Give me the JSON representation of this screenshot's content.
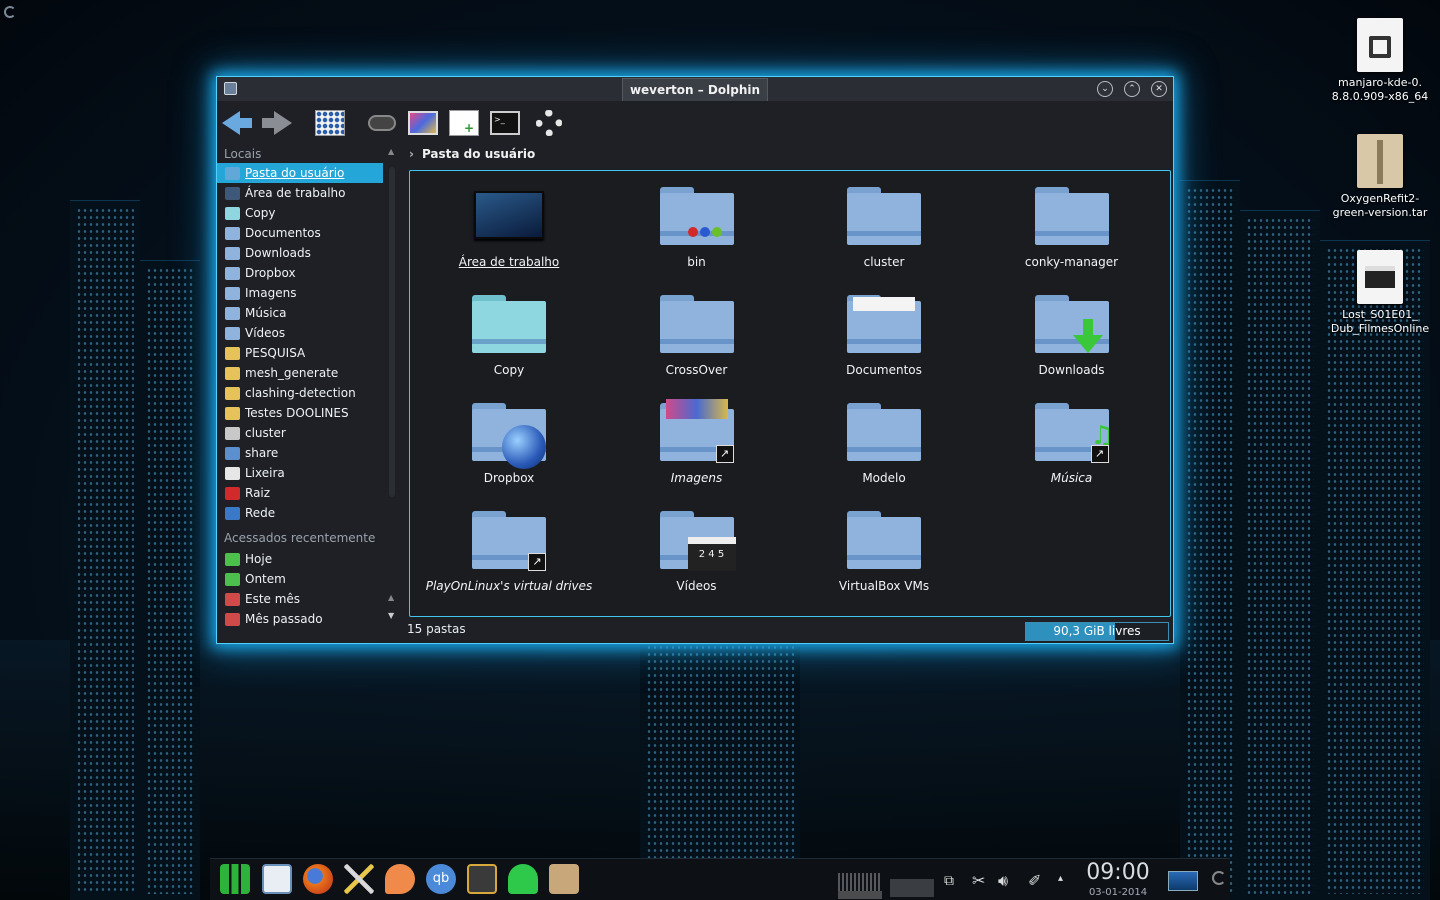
{
  "window": {
    "title": "weverton – Dolphin",
    "buttons": {
      "minimize": "⌄",
      "maximize": "⌃",
      "close": "✕"
    }
  },
  "sidebar": {
    "places_title": "Locais",
    "places": [
      {
        "label": "Pasta do usuário",
        "icon": "home-folder-icon",
        "color": "#5fa8d8",
        "selected": true
      },
      {
        "label": "Área de trabalho",
        "icon": "desktop-icon",
        "color": "#3d5878"
      },
      {
        "label": "Copy",
        "icon": "folder-icon",
        "color": "#8ed6e0"
      },
      {
        "label": "Documentos",
        "icon": "documents-folder-icon",
        "color": "#8fb3dd"
      },
      {
        "label": "Downloads",
        "icon": "downloads-folder-icon",
        "color": "#8fb3dd"
      },
      {
        "label": "Dropbox",
        "icon": "dropbox-folder-icon",
        "color": "#8fb3dd"
      },
      {
        "label": "Imagens",
        "icon": "pictures-folder-icon",
        "color": "#8fb3dd"
      },
      {
        "label": "Música",
        "icon": "music-folder-icon",
        "color": "#8fb3dd"
      },
      {
        "label": "Vídeos",
        "icon": "videos-folder-icon",
        "color": "#8fb3dd"
      },
      {
        "label": "PESQUISA",
        "icon": "yellow-folder-icon",
        "color": "#e6c25a"
      },
      {
        "label": "mesh_generate",
        "icon": "yellow-folder-icon",
        "color": "#e6c25a"
      },
      {
        "label": "clashing-detection",
        "icon": "yellow-folder-icon",
        "color": "#e6c25a"
      },
      {
        "label": "Testes DOOLINES",
        "icon": "yellow-folder-icon",
        "color": "#e6c25a"
      },
      {
        "label": "cluster",
        "icon": "drive-icon",
        "color": "#c8c8c8"
      },
      {
        "label": "share",
        "icon": "network-share-icon",
        "color": "#5b8fd0"
      },
      {
        "label": "Lixeira",
        "icon": "trash-icon",
        "color": "#e6e6e6"
      },
      {
        "label": "Raiz",
        "icon": "root-folder-icon",
        "color": "#d02a2a"
      },
      {
        "label": "Rede",
        "icon": "network-globe-icon",
        "color": "#3a78c8"
      }
    ],
    "recent_title": "Acessados recentemente",
    "recent": [
      {
        "label": "Hoje",
        "icon": "calendar-today-icon",
        "color": "#4cbf4c"
      },
      {
        "label": "Ontem",
        "icon": "calendar-yesterday-icon",
        "color": "#4cbf4c"
      },
      {
        "label": "Este mês",
        "icon": "calendar-month-icon",
        "color": "#d04a4a"
      },
      {
        "label": "Mês passado",
        "icon": "calendar-last-month-icon",
        "color": "#d04a4a"
      }
    ]
  },
  "breadcrumb": {
    "chevron": "›",
    "path": "Pasta do usuário"
  },
  "files": [
    {
      "name": "Área de trabalho",
      "kind": "desktop",
      "underline": true
    },
    {
      "name": "bin",
      "kind": "folder-dots"
    },
    {
      "name": "cluster",
      "kind": "folder"
    },
    {
      "name": "conky-manager",
      "kind": "folder"
    },
    {
      "name": "Copy",
      "kind": "folder-teal"
    },
    {
      "name": "CrossOver",
      "kind": "folder"
    },
    {
      "name": "Documentos",
      "kind": "folder-docs"
    },
    {
      "name": "Downloads",
      "kind": "folder-download"
    },
    {
      "name": "Dropbox",
      "kind": "folder-globe"
    },
    {
      "name": "Imagens",
      "kind": "folder-images",
      "italic": true,
      "link": true
    },
    {
      "name": "Modelo",
      "kind": "folder"
    },
    {
      "name": "Música",
      "kind": "folder-music",
      "italic": true,
      "link": true
    },
    {
      "name": "PlayOnLinux's virtual drives",
      "kind": "folder",
      "italic": true,
      "link": true
    },
    {
      "name": "Vídeos",
      "kind": "folder-video"
    },
    {
      "name": "VirtualBox VMs",
      "kind": "folder"
    }
  ],
  "status": {
    "count": "15 pastas",
    "free": "90,3 GiB livres",
    "used_fraction": 0.63
  },
  "desktop_icons": [
    {
      "line1": "manjaro-kde-0.",
      "line2": "8.8.0.909-x86_64",
      "icon": "qr-iso-icon"
    },
    {
      "line1": "OxygenRefit2-",
      "line2": "green-version.tar",
      "icon": "archive-box-icon"
    },
    {
      "line1": "Lost_S01E01_",
      "line2": "Dub_FilmesOnline",
      "icon": "video-clapper-icon"
    }
  ],
  "taskbar": {
    "time": "09:00",
    "date": "03-01-2014"
  },
  "colors": {
    "accent": "#25a6d9",
    "glow": "#1aa6e8",
    "folder": "#8fb3dd"
  }
}
